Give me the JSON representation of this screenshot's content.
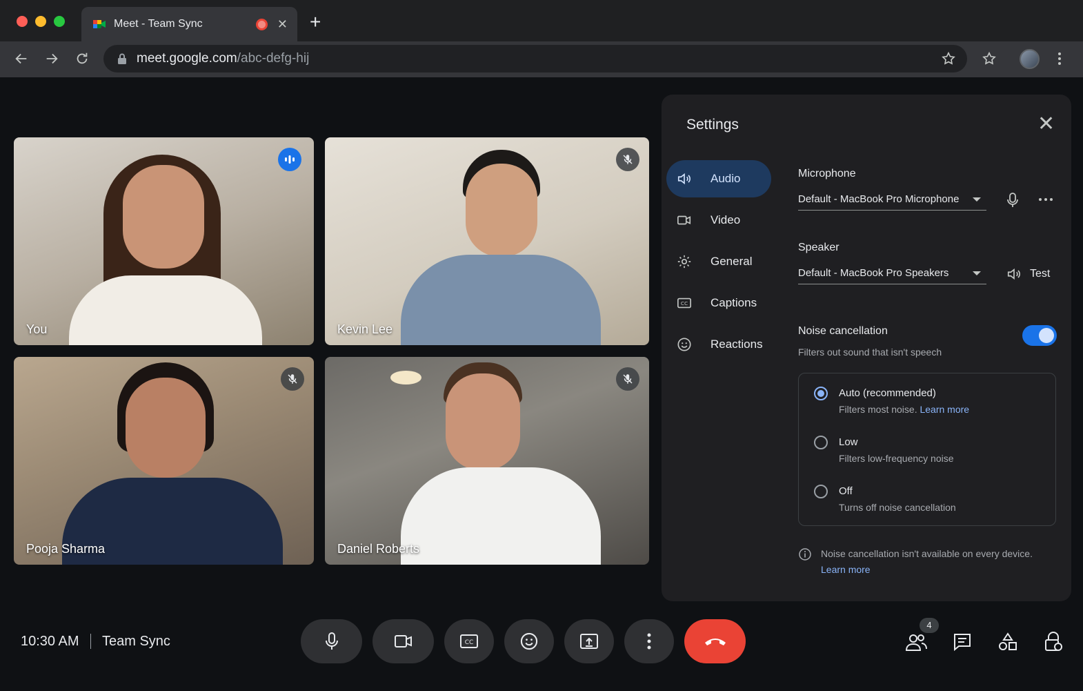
{
  "browser": {
    "tab_title": "Meet - Team Sync",
    "url_host": "meet.google.com",
    "url_path": "/abc-defg-hij"
  },
  "tiles": [
    {
      "name": "You",
      "status": "speaking"
    },
    {
      "name": "Kevin Lee",
      "status": "muted"
    },
    {
      "name": "Pooja Sharma",
      "status": "muted"
    },
    {
      "name": "Daniel Roberts",
      "status": "muted"
    }
  ],
  "settings": {
    "title": "Settings",
    "nav": [
      {
        "label": "Audio",
        "icon": "speaker-icon",
        "active": true
      },
      {
        "label": "Video",
        "icon": "video-camera-icon"
      },
      {
        "label": "General",
        "icon": "gear-icon"
      },
      {
        "label": "Captions",
        "icon": "captions-icon"
      },
      {
        "label": "Reactions",
        "icon": "smiley-icon"
      }
    ],
    "microphone_label": "Microphone",
    "microphone_value": "Default - MacBook Pro Microphone",
    "speaker_label": "Speaker",
    "speaker_value": "Default - MacBook Pro Speakers",
    "test_label": "Test",
    "noise_title": "Noise cancellation",
    "noise_sub": "Filters out sound that isn't speech",
    "noise_enabled": true,
    "options": [
      {
        "title": "Auto (recommended)",
        "sub": "Filters most noise.",
        "link": "Learn more",
        "selected": true
      },
      {
        "title": "Low",
        "sub": "Filters low-frequency noise",
        "selected": false
      },
      {
        "title": "Off",
        "sub": "Turns off noise cancellation",
        "selected": false
      }
    ],
    "info_text": "Noise cancellation isn't available on every device.",
    "info_link": "Learn more"
  },
  "bottom": {
    "time": "10:30 AM",
    "meeting_name": "Team Sync",
    "participants_count": "4"
  },
  "colors": {
    "accent": "#1a73e8",
    "end_call": "#ea4335",
    "link": "#8ab4f8"
  }
}
